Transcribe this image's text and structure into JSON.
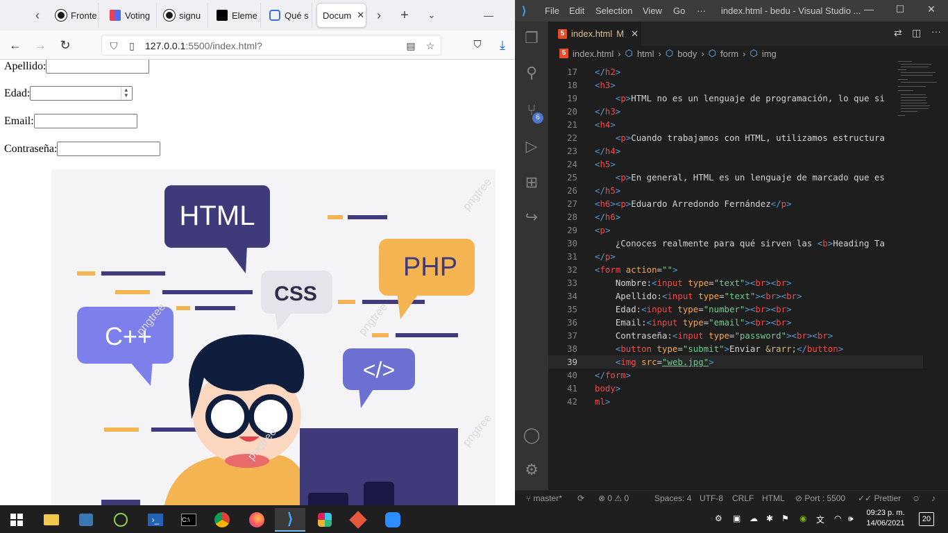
{
  "browser": {
    "tabs": [
      {
        "label": "Fronte",
        "icon": "github-icon"
      },
      {
        "label": "Voting",
        "icon": "voting-icon"
      },
      {
        "label": "signu",
        "icon": "github-icon"
      },
      {
        "label": "Eleme",
        "icon": "element-icon"
      },
      {
        "label": "Qué s",
        "icon": "doc-icon"
      },
      {
        "label": "Docum",
        "icon": "doc-icon"
      }
    ],
    "url_host": "127.0.0.1",
    "url_rest": ":5500/index.html?",
    "page": {
      "apellido_label": "Apellido:",
      "edad_label": "Edad:",
      "email_label": "Email:",
      "contrasena_label": "Contraseña:"
    },
    "hero": {
      "html_bubble": "HTML",
      "css_bubble": "CSS",
      "php_bubble": "PHP",
      "cpp_bubble": "C++",
      "tag_bubble": "</>",
      "watermark": "pngtree"
    }
  },
  "vscode": {
    "menu": [
      "File",
      "Edit",
      "Selection",
      "View",
      "Go",
      "···"
    ],
    "window_title": "index.html - bedu - Visual Studio ...",
    "scm_badge": "6",
    "tab_label": "index.html",
    "tab_modified": "M",
    "breadcrumbs": [
      "index.html",
      "html",
      "body",
      "form",
      "img"
    ],
    "code_lines": [
      {
        "n": "17",
        "parts": [
          [
            "tag",
            "</"
          ],
          [
            "tagn",
            "h2"
          ],
          [
            "tag",
            ">"
          ]
        ]
      },
      {
        "n": "18",
        "parts": [
          [
            "tag",
            "<"
          ],
          [
            "tagn",
            "h3"
          ],
          [
            "tag",
            ">"
          ]
        ]
      },
      {
        "n": "19",
        "parts": [
          [
            "txt",
            "    "
          ],
          [
            "tag",
            "<"
          ],
          [
            "tagn",
            "p"
          ],
          [
            "tag",
            ">"
          ],
          [
            "txt",
            "HTML no es un lenguaje de programación, lo que si"
          ]
        ]
      },
      {
        "n": "20",
        "parts": [
          [
            "tag",
            "</"
          ],
          [
            "tagn",
            "h3"
          ],
          [
            "tag",
            ">"
          ]
        ]
      },
      {
        "n": "21",
        "parts": [
          [
            "tag",
            "<"
          ],
          [
            "tagn",
            "h4"
          ],
          [
            "tag",
            ">"
          ]
        ]
      },
      {
        "n": "22",
        "parts": [
          [
            "txt",
            "    "
          ],
          [
            "tag",
            "<"
          ],
          [
            "tagn",
            "p"
          ],
          [
            "tag",
            ">"
          ],
          [
            "txt",
            "Cuando trabajamos con HTML, utilizamos estructura"
          ]
        ]
      },
      {
        "n": "23",
        "parts": [
          [
            "tag",
            "</"
          ],
          [
            "tagn",
            "h4"
          ],
          [
            "tag",
            ">"
          ]
        ]
      },
      {
        "n": "24",
        "parts": [
          [
            "tag",
            "<"
          ],
          [
            "tagn",
            "h5"
          ],
          [
            "tag",
            ">"
          ]
        ]
      },
      {
        "n": "25",
        "parts": [
          [
            "txt",
            "    "
          ],
          [
            "tag",
            "<"
          ],
          [
            "tagn",
            "p"
          ],
          [
            "tag",
            ">"
          ],
          [
            "txt",
            "En general, HTML es un lenguaje de marcado que es"
          ]
        ]
      },
      {
        "n": "26",
        "parts": [
          [
            "tag",
            "</"
          ],
          [
            "tagn",
            "h5"
          ],
          [
            "tag",
            ">"
          ]
        ]
      },
      {
        "n": "27",
        "parts": [
          [
            "tag",
            "<"
          ],
          [
            "tagn",
            "h6"
          ],
          [
            "tag",
            "><"
          ],
          [
            "tagn",
            "p"
          ],
          [
            "tag",
            ">"
          ],
          [
            "txt",
            "Eduardo Arredondo Fernández"
          ],
          [
            "tag",
            "</"
          ],
          [
            "tagn",
            "p"
          ],
          [
            "tag",
            ">"
          ]
        ]
      },
      {
        "n": "28",
        "parts": [
          [
            "tag",
            "</"
          ],
          [
            "tagn",
            "h6"
          ],
          [
            "tag",
            ">"
          ]
        ]
      },
      {
        "n": "29",
        "parts": [
          [
            "tag",
            "<"
          ],
          [
            "tagn",
            "p"
          ],
          [
            "tag",
            ">"
          ]
        ]
      },
      {
        "n": "30",
        "parts": [
          [
            "txt",
            "    ¿Conoces realmente para qué sirven las "
          ],
          [
            "tag",
            "<"
          ],
          [
            "tagn",
            "b"
          ],
          [
            "tag",
            ">"
          ],
          [
            "txt",
            "Heading Ta"
          ]
        ]
      },
      {
        "n": "31",
        "parts": [
          [
            "tag",
            "</"
          ],
          [
            "tagn",
            "p"
          ],
          [
            "tag",
            ">"
          ]
        ]
      },
      {
        "n": "32",
        "parts": [
          [
            "tag",
            "<"
          ],
          [
            "tagn",
            "form"
          ],
          [
            "txt",
            " "
          ],
          [
            "attr",
            "action"
          ],
          [
            "txt",
            "="
          ],
          [
            "str",
            "\"\""
          ],
          [
            "tag",
            ">"
          ]
        ]
      },
      {
        "n": "33",
        "parts": [
          [
            "txt",
            "    Nombre:"
          ],
          [
            "tag",
            "<"
          ],
          [
            "tagn",
            "input"
          ],
          [
            "txt",
            " "
          ],
          [
            "attr",
            "type"
          ],
          [
            "txt",
            "="
          ],
          [
            "str",
            "\"text\""
          ],
          [
            "tag",
            "><"
          ],
          [
            "tagn",
            "br"
          ],
          [
            "tag",
            "><"
          ],
          [
            "tagn",
            "br"
          ],
          [
            "tag",
            ">"
          ]
        ]
      },
      {
        "n": "34",
        "parts": [
          [
            "txt",
            "    Apellido:"
          ],
          [
            "tag",
            "<"
          ],
          [
            "tagn",
            "input"
          ],
          [
            "txt",
            " "
          ],
          [
            "attr",
            "type"
          ],
          [
            "txt",
            "="
          ],
          [
            "str",
            "\"text\""
          ],
          [
            "tag",
            "><"
          ],
          [
            "tagn",
            "br"
          ],
          [
            "tag",
            "><"
          ],
          [
            "tagn",
            "br"
          ],
          [
            "tag",
            ">"
          ]
        ]
      },
      {
        "n": "35",
        "parts": [
          [
            "txt",
            "    Edad:"
          ],
          [
            "tag",
            "<"
          ],
          [
            "tagn",
            "input"
          ],
          [
            "txt",
            " "
          ],
          [
            "attr",
            "type"
          ],
          [
            "txt",
            "="
          ],
          [
            "str",
            "\"number\""
          ],
          [
            "tag",
            "><"
          ],
          [
            "tagn",
            "br"
          ],
          [
            "tag",
            "><"
          ],
          [
            "tagn",
            "br"
          ],
          [
            "tag",
            ">"
          ]
        ]
      },
      {
        "n": "36",
        "parts": [
          [
            "txt",
            "    Email:"
          ],
          [
            "tag",
            "<"
          ],
          [
            "tagn",
            "input"
          ],
          [
            "txt",
            " "
          ],
          [
            "attr",
            "type"
          ],
          [
            "txt",
            "="
          ],
          [
            "str",
            "\"email\""
          ],
          [
            "tag",
            "><"
          ],
          [
            "tagn",
            "br"
          ],
          [
            "tag",
            "><"
          ],
          [
            "tagn",
            "br"
          ],
          [
            "tag",
            ">"
          ]
        ]
      },
      {
        "n": "37",
        "parts": [
          [
            "txt",
            "    Contraseña:"
          ],
          [
            "tag",
            "<"
          ],
          [
            "tagn",
            "input"
          ],
          [
            "txt",
            " "
          ],
          [
            "attr",
            "type"
          ],
          [
            "txt",
            "="
          ],
          [
            "str",
            "\"password\""
          ],
          [
            "tag",
            "><"
          ],
          [
            "tagn",
            "br"
          ],
          [
            "tag",
            "><"
          ],
          [
            "tagn",
            "br"
          ],
          [
            "tag",
            ">"
          ]
        ]
      },
      {
        "n": "38",
        "parts": [
          [
            "txt",
            "    "
          ],
          [
            "tag",
            "<"
          ],
          [
            "tagn",
            "button"
          ],
          [
            "txt",
            " "
          ],
          [
            "attr",
            "type"
          ],
          [
            "txt",
            "="
          ],
          [
            "str",
            "\"submit\""
          ],
          [
            "tag",
            ">"
          ],
          [
            "txt",
            "Enviar "
          ],
          [
            "ent",
            "&rarr;"
          ],
          [
            "tag",
            "</"
          ],
          [
            "tagn",
            "button"
          ],
          [
            "tag",
            ">"
          ]
        ]
      },
      {
        "n": "39",
        "parts": [
          [
            "txt",
            "    "
          ],
          [
            "tag",
            "<"
          ],
          [
            "tagn",
            "img"
          ],
          [
            "txt",
            " "
          ],
          [
            "attr",
            "src"
          ],
          [
            "txt",
            "="
          ],
          [
            "str",
            "\"web.jpg\""
          ],
          [
            "tag",
            ">"
          ]
        ],
        "current": true
      },
      {
        "n": "40",
        "parts": [
          [
            "tag",
            "</"
          ],
          [
            "tagn",
            "form"
          ],
          [
            "tag",
            ">"
          ]
        ]
      },
      {
        "n": "41",
        "parts": [
          [
            "tagn",
            "body"
          ],
          [
            "tag",
            ">"
          ]
        ]
      },
      {
        "n": "42",
        "parts": [
          [
            "tagn",
            "ml"
          ],
          [
            "tag",
            ">"
          ]
        ]
      }
    ],
    "status": {
      "branch": "master*",
      "problems": "⊗ 0 ⚠ 0",
      "spaces": "Spaces: 4",
      "encoding": "UTF-8",
      "eol": "CRLF",
      "language": "HTML",
      "port": "Port : 5500",
      "prettier": "Prettier"
    }
  },
  "taskbar": {
    "time": "09:23 p. m.",
    "date": "14/06/2021",
    "notifications": "20"
  }
}
